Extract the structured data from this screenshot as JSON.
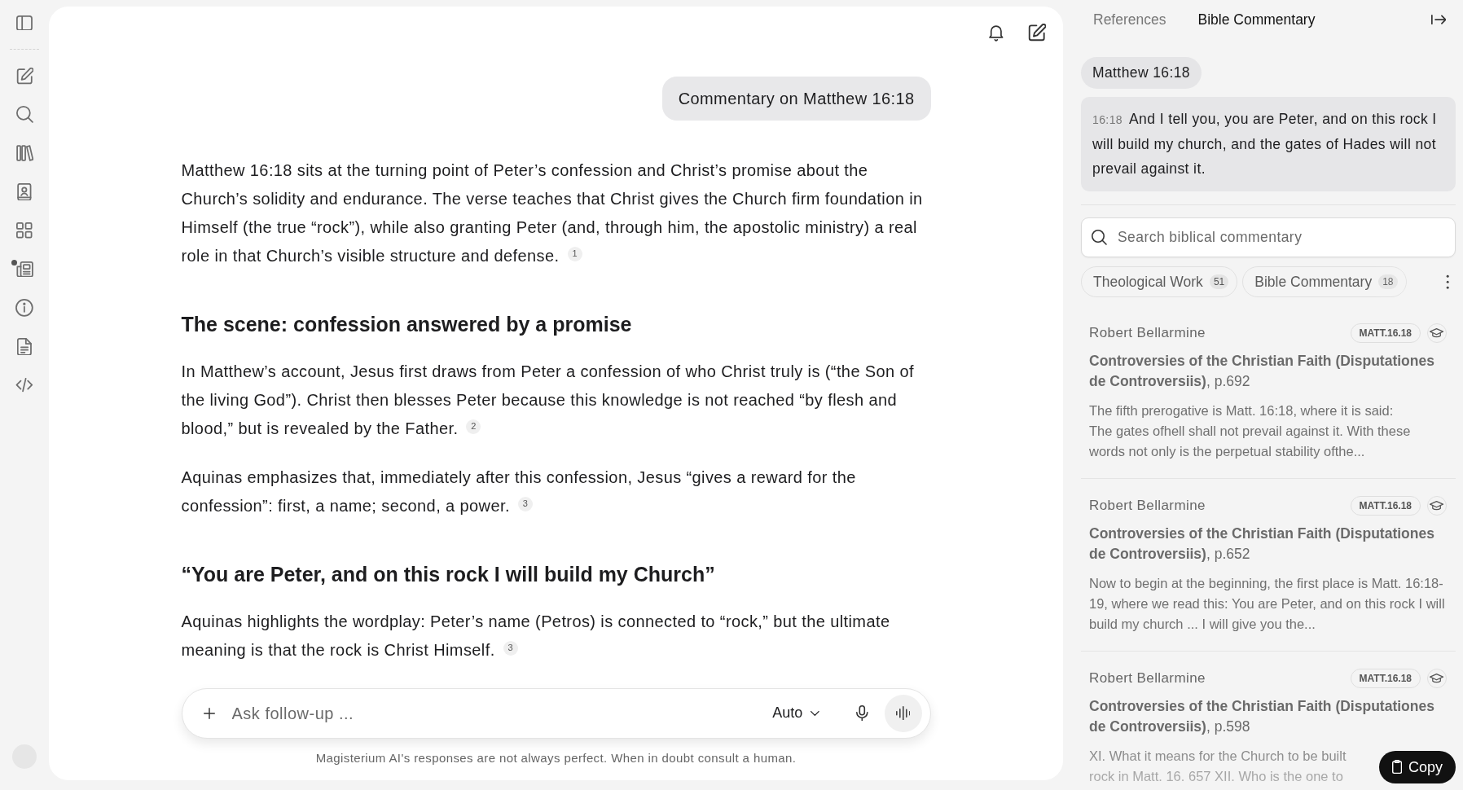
{
  "sidebar": {
    "items": [
      {
        "kind": "compose",
        "unread": false
      },
      {
        "kind": "search",
        "unread": false
      },
      {
        "kind": "library",
        "unread": false
      },
      {
        "kind": "contacts",
        "unread": false
      },
      {
        "kind": "apps",
        "unread": false
      },
      {
        "kind": "news",
        "unread": true
      },
      {
        "kind": "info",
        "unread": false
      },
      {
        "kind": "document",
        "unread": false
      },
      {
        "kind": "code",
        "unread": false
      }
    ]
  },
  "chat": {
    "query": "Commentary on Matthew 16:18",
    "answer": [
      {
        "kind": "paragraph",
        "text": "Matthew 16:18 sits at the turning point of Peter’s confession and Christ’s promise about the Church’s solidity and endurance. The verse teaches that Christ gives the Church firm foundation in Himself (the true “rock”), while also granting Peter (and, through him, the apostolic ministry) a real role in that Church’s visible structure and defense.",
        "citation": "1"
      },
      {
        "kind": "heading",
        "text": "The scene: confession answered by a promise"
      },
      {
        "kind": "paragraph",
        "text": "In Matthew’s account, Jesus first draws from Peter a confession of who Christ truly is (“the Son of the living God”). Christ then blesses Peter because this knowledge is not reached “by flesh and blood,” but is revealed by the Father.",
        "citation": "2"
      },
      {
        "kind": "paragraph",
        "text": "Aquinas emphasizes that, immediately after this confession, Jesus “gives a reward for the confession”: first, a name; second, a power.",
        "citation": "3"
      },
      {
        "kind": "heading",
        "text": "“You are Peter, and on this rock I will build my Church”"
      },
      {
        "kind": "paragraph",
        "text": "Aquinas highlights the wordplay: Peter’s name (Petros) is connected to “rock,” but the ultimate meaning is that the rock is Christ Himself.",
        "citation": "3"
      }
    ]
  },
  "composer": {
    "placeholder": "Ask follow-up ...",
    "mode": "Auto",
    "disclaimer": "Magisterium AI's responses are not always perfect. When in doubt consult a human."
  },
  "panel": {
    "tabs": [
      {
        "label": "References",
        "selected": false
      },
      {
        "label": "Bible Commentary",
        "selected": true
      }
    ],
    "verse": {
      "reference": "Matthew 16:18",
      "number": "16:18",
      "text": "And I tell you, you are Peter, and on this rock I will build my church, and the gates of Hades will not prevail against it."
    },
    "search": {
      "placeholder": "Search biblical commentary"
    },
    "filters": [
      {
        "label": "Theological Work",
        "count": "51"
      },
      {
        "label": "Bible Commentary",
        "count": "18"
      }
    ],
    "results": [
      {
        "author": "Robert Bellarmine",
        "reference": "MATT.16.18",
        "title": "**Controversies of the Christian Faith (Disputationes de Controversiis)**, p.692",
        "excerpt": "The fifth prerogative is Matt. 16:18, where it is said:\nThe gates ofhell shall not prevail against it. With these words not only is the perpetual stability ofthe..."
      },
      {
        "author": "Robert Bellarmine",
        "reference": "MATT.16.18",
        "title": "**Controversies of the Christian Faith (Disputationes de Controversiis)**, p.652",
        "excerpt": "Now to begin at the beginning, the first place is Matt. 16:18-19, where we read this: You are Peter, and on this rock I will build my church ... I will give you the..."
      },
      {
        "author": "Robert Bellarmine",
        "reference": "MATT.16.18",
        "title": "**Controversies of the Christian Faith (Disputationes de Controversiis)**, p.598",
        "excerpt": "XI. What it means for the Church to be built\nrock in Matt. 16. 657 XII. Who is the one to"
      }
    ],
    "copy_button": "Copy"
  }
}
